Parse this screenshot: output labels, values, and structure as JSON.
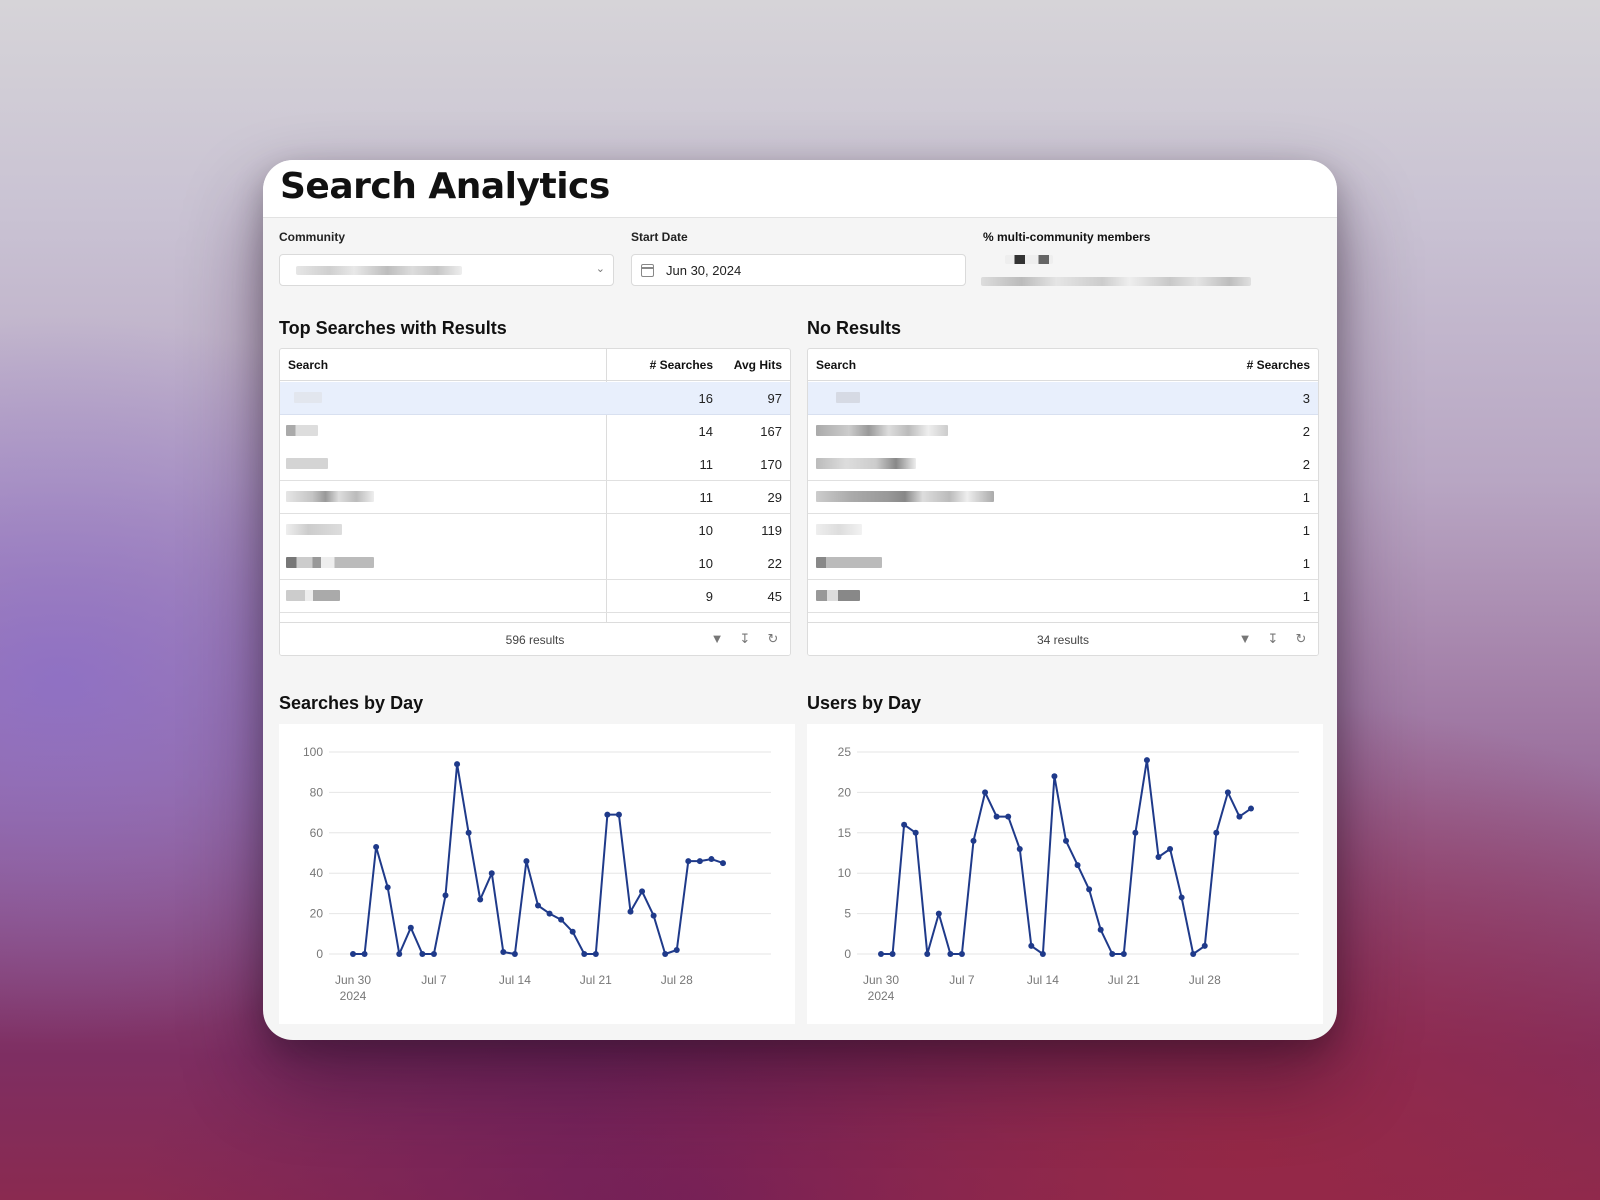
{
  "header": {
    "title": "Search Analytics"
  },
  "filters": {
    "community_label": "Community",
    "start_date_label": "Start Date",
    "start_date_value": "Jun 30, 2024",
    "multi_label": "% multi-community members"
  },
  "top_searches": {
    "title": "Top Searches with Results",
    "columns": [
      "Search",
      "# Searches",
      "Avg Hits"
    ],
    "rows": [
      {
        "searches": "16",
        "avg": "97"
      },
      {
        "searches": "14",
        "avg": "167"
      },
      {
        "searches": "11",
        "avg": "170"
      },
      {
        "searches": "11",
        "avg": "29"
      },
      {
        "searches": "10",
        "avg": "119"
      },
      {
        "searches": "10",
        "avg": "22"
      },
      {
        "searches": "9",
        "avg": "45"
      }
    ],
    "footer": "596 results"
  },
  "no_results": {
    "title": "No Results",
    "columns": [
      "Search",
      "# Searches"
    ],
    "rows": [
      {
        "searches": "3"
      },
      {
        "searches": "2"
      },
      {
        "searches": "2"
      },
      {
        "searches": "1"
      },
      {
        "searches": "1"
      },
      {
        "searches": "1"
      },
      {
        "searches": "1"
      }
    ],
    "footer": "34 results"
  },
  "icons": [
    "filter-icon",
    "download-icon",
    "refresh-icon",
    "calendar-icon",
    "chevron-down-icon"
  ],
  "colors": {
    "series": "#1f3a8a",
    "selected_row": "#e8effc"
  },
  "chart_data": [
    {
      "type": "line",
      "title": "Searches by Day",
      "x": [
        "2024-06-30",
        "2024-07-01",
        "2024-07-02",
        "2024-07-03",
        "2024-07-04",
        "2024-07-05",
        "2024-07-06",
        "2024-07-07",
        "2024-07-08",
        "2024-07-09",
        "2024-07-10",
        "2024-07-11",
        "2024-07-12",
        "2024-07-13",
        "2024-07-14",
        "2024-07-15",
        "2024-07-16",
        "2024-07-17",
        "2024-07-18",
        "2024-07-19",
        "2024-07-20",
        "2024-07-21",
        "2024-07-22",
        "2024-07-23",
        "2024-07-24",
        "2024-07-25",
        "2024-07-26",
        "2024-07-27",
        "2024-07-28",
        "2024-07-29",
        "2024-07-30",
        "2024-07-31",
        "2024-08-01"
      ],
      "values": [
        0,
        0,
        53,
        33,
        0,
        13,
        0,
        0,
        29,
        94,
        60,
        27,
        40,
        1,
        0,
        46,
        24,
        20,
        17,
        11,
        0,
        0,
        69,
        69,
        21,
        31,
        19,
        0,
        2,
        46,
        46,
        47,
        45
      ],
      "ylim": [
        0,
        100
      ],
      "yticks": [
        "100",
        "80",
        "60",
        "40",
        "20",
        "0"
      ],
      "ytick_values": [
        100,
        80,
        60,
        40,
        20,
        0
      ],
      "xticks": [
        {
          "date": "2024-06-30",
          "label": "Jun 30",
          "sub": "2024"
        },
        {
          "date": "2024-07-07",
          "label": "Jul 7",
          "sub": ""
        },
        {
          "date": "2024-07-14",
          "label": "Jul 14",
          "sub": ""
        },
        {
          "date": "2024-07-21",
          "label": "Jul 21",
          "sub": ""
        },
        {
          "date": "2024-07-28",
          "label": "Jul 28",
          "sub": ""
        }
      ],
      "grid": true
    },
    {
      "type": "line",
      "title": "Users by Day",
      "x": [
        "2024-06-30",
        "2024-07-01",
        "2024-07-02",
        "2024-07-03",
        "2024-07-04",
        "2024-07-05",
        "2024-07-06",
        "2024-07-07",
        "2024-07-08",
        "2024-07-09",
        "2024-07-10",
        "2024-07-11",
        "2024-07-12",
        "2024-07-13",
        "2024-07-14",
        "2024-07-15",
        "2024-07-16",
        "2024-07-17",
        "2024-07-18",
        "2024-07-19",
        "2024-07-20",
        "2024-07-21",
        "2024-07-22",
        "2024-07-23",
        "2024-07-24",
        "2024-07-25",
        "2024-07-26",
        "2024-07-27",
        "2024-07-28",
        "2024-07-29",
        "2024-07-30",
        "2024-07-31",
        "2024-08-01"
      ],
      "values": [
        0,
        0,
        16,
        15,
        0,
        5,
        0,
        0,
        14,
        20,
        17,
        17,
        13,
        1,
        0,
        22,
        14,
        11,
        8,
        3,
        0,
        0,
        15,
        24,
        12,
        13,
        7,
        0,
        1,
        15,
        20,
        17,
        18
      ],
      "ylim": [
        0,
        25
      ],
      "yticks": [
        "25",
        "20",
        "15",
        "10",
        "5",
        "0"
      ],
      "ytick_values": [
        25,
        20,
        15,
        10,
        5,
        0
      ],
      "xticks": [
        {
          "date": "2024-06-30",
          "label": "Jun 30",
          "sub": "2024"
        },
        {
          "date": "2024-07-07",
          "label": "Jul 7",
          "sub": ""
        },
        {
          "date": "2024-07-14",
          "label": "Jul 14",
          "sub": ""
        },
        {
          "date": "2024-07-21",
          "label": "Jul 21",
          "sub": ""
        },
        {
          "date": "2024-07-28",
          "label": "Jul 28",
          "sub": ""
        }
      ],
      "grid": true
    }
  ]
}
